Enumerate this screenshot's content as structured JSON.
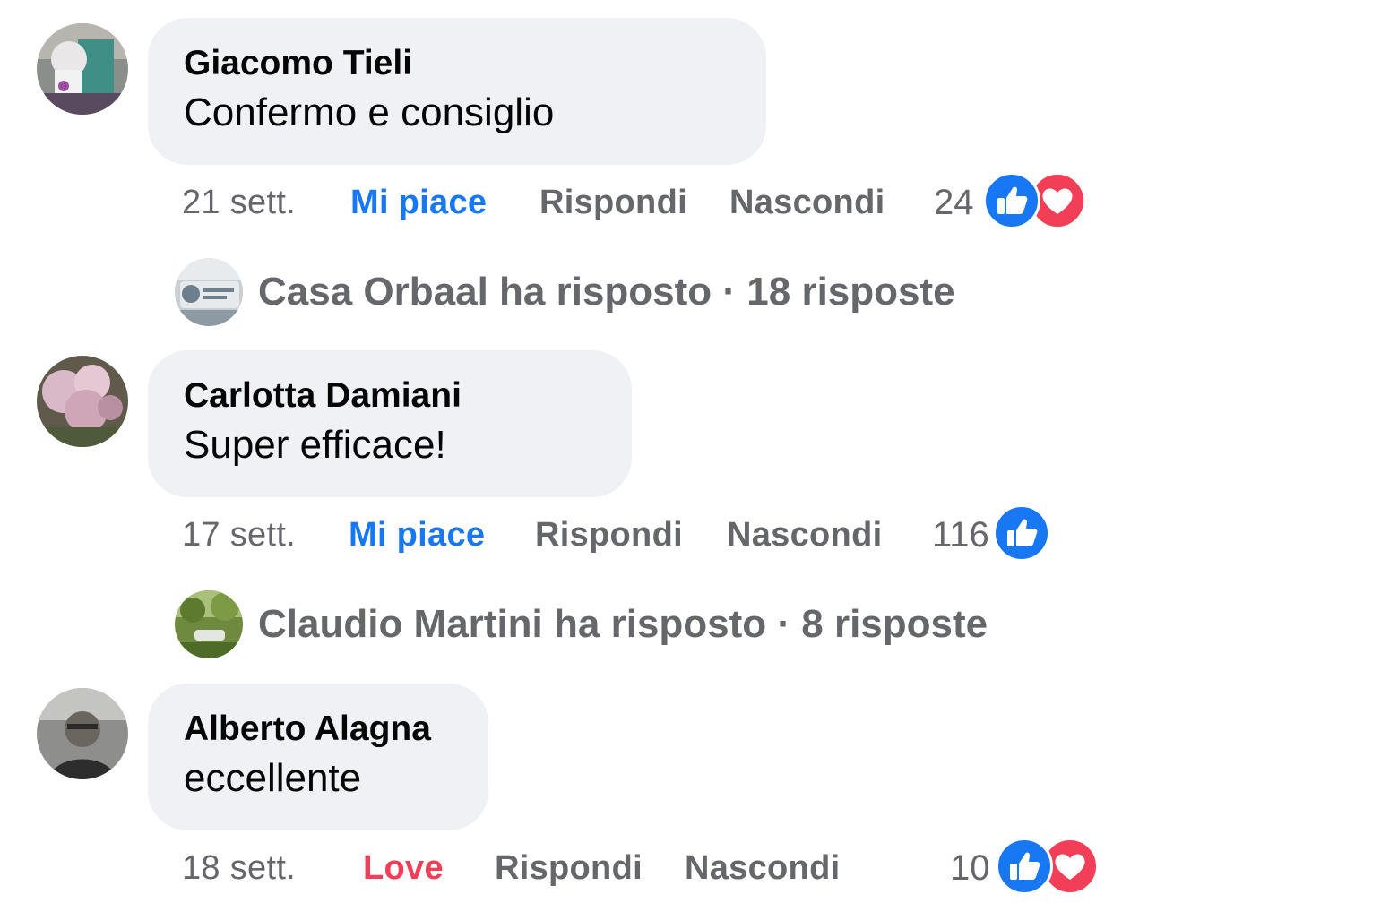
{
  "comments": [
    {
      "author": "Giacomo Tieli",
      "text": "Confermo e consiglio",
      "time": "21 sett.",
      "reaction_label": "Mi piace",
      "reply_label": "Rispondi",
      "hide_label": "Nascondi",
      "reaction_count": "24",
      "reactions": [
        "like-icon",
        "love-icon"
      ],
      "replies_summary": "Casa Orbaal ha risposto · 18 risposte"
    },
    {
      "author": "Carlotta Damiani",
      "text": "Super efficace!",
      "time": "17 sett.",
      "reaction_label": "Mi piace",
      "reply_label": "Rispondi",
      "hide_label": "Nascondi",
      "reaction_count": "116",
      "reactions": [
        "like-icon"
      ],
      "replies_summary": "Claudio Martini ha risposto · 8 risposte"
    },
    {
      "author": "Alberto Alagna",
      "text": "eccellente",
      "time": "18 sett.",
      "reaction_label": "Love",
      "reply_label": "Rispondi",
      "hide_label": "Nascondi",
      "reaction_count": "10",
      "reactions": [
        "like-icon",
        "love-icon"
      ]
    }
  ],
  "colors": {
    "bubble": "#eff1f4",
    "like_blue": "#1877f2",
    "love_red": "#f33e58",
    "secondary_text": "#65676b",
    "primary_text": "#050505"
  }
}
